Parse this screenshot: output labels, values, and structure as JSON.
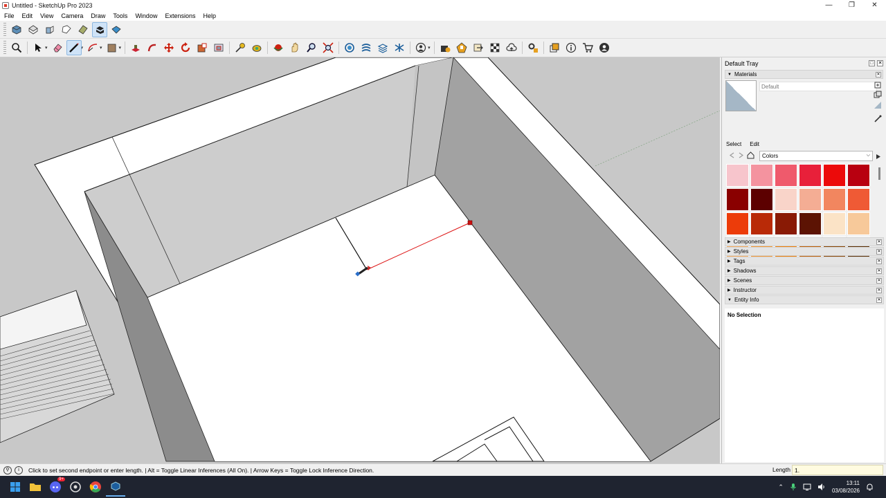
{
  "window": {
    "title": "Untitled - SketchUp Pro 2023",
    "controls": [
      "minimize",
      "maximize",
      "close"
    ]
  },
  "menu": [
    "File",
    "Edit",
    "View",
    "Camera",
    "Draw",
    "Tools",
    "Window",
    "Extensions",
    "Help"
  ],
  "toolbar_row1": [
    "iso-view-icon",
    "top-view-icon",
    "front-view-icon",
    "right-view-icon",
    "back-view-icon",
    "left-view-icon",
    "bottom-view-icon"
  ],
  "toolbar_row2": {
    "active_tool": "line-tool",
    "tools": [
      "search-icon",
      "select-tool",
      "eraser-tool",
      "line-tool",
      "arc-tool",
      "shape-tool",
      "push-pull-tool",
      "follow-me-tool",
      "move-tool",
      "rotate-tool",
      "scale-tool",
      "offset-tool",
      "tape-measure-tool",
      "paint-bucket-tool",
      "orbit-tool",
      "pan-tool",
      "zoom-tool",
      "zoom-extents-tool",
      "solid-tools",
      "sandbox-tools",
      "section-plane-tool",
      "warehouse-icon",
      "add-location-icon",
      "extension-warehouse-icon",
      "account-icon"
    ]
  },
  "tray": {
    "title": "Default Tray",
    "materials": {
      "header": "Materials",
      "current_name": "Default",
      "tabs": [
        "Select",
        "Edit"
      ],
      "active_tab": "Select",
      "library": "Colors",
      "swatches": [
        "#f7c5cc",
        "#f4939f",
        "#ef5a6c",
        "#e8203a",
        "#ec0a0a",
        "#b80010",
        "#8a0000",
        "#5c0000",
        "#f9d4c9",
        "#f4ad94",
        "#f2865f",
        "#ef5a35",
        "#ec3c0a",
        "#b92a07",
        "#891a05",
        "#5c1303",
        "#fbe3c6",
        "#f7c99a",
        "#f6ad60",
        "#f39833",
        "#ef7f07",
        "#bf5e04",
        "#8a4503",
        "#5b2e02"
      ]
    },
    "panels": [
      "Components",
      "Styles",
      "Tags",
      "Shadows",
      "Scenes",
      "Instructor"
    ],
    "entity_info": {
      "header": "Entity Info",
      "status": "No Selection"
    }
  },
  "statusbar": {
    "hint": "Click to set second endpoint or enter length. | Alt = Toggle Linear Inferences (All On). | Arrow Keys = Toggle Lock Inference Direction.",
    "measurement_label": "Length",
    "measurement_value": "1."
  },
  "taskbar": {
    "discord_badge": "9+",
    "time": "13:11",
    "date": "03/08/2026"
  }
}
